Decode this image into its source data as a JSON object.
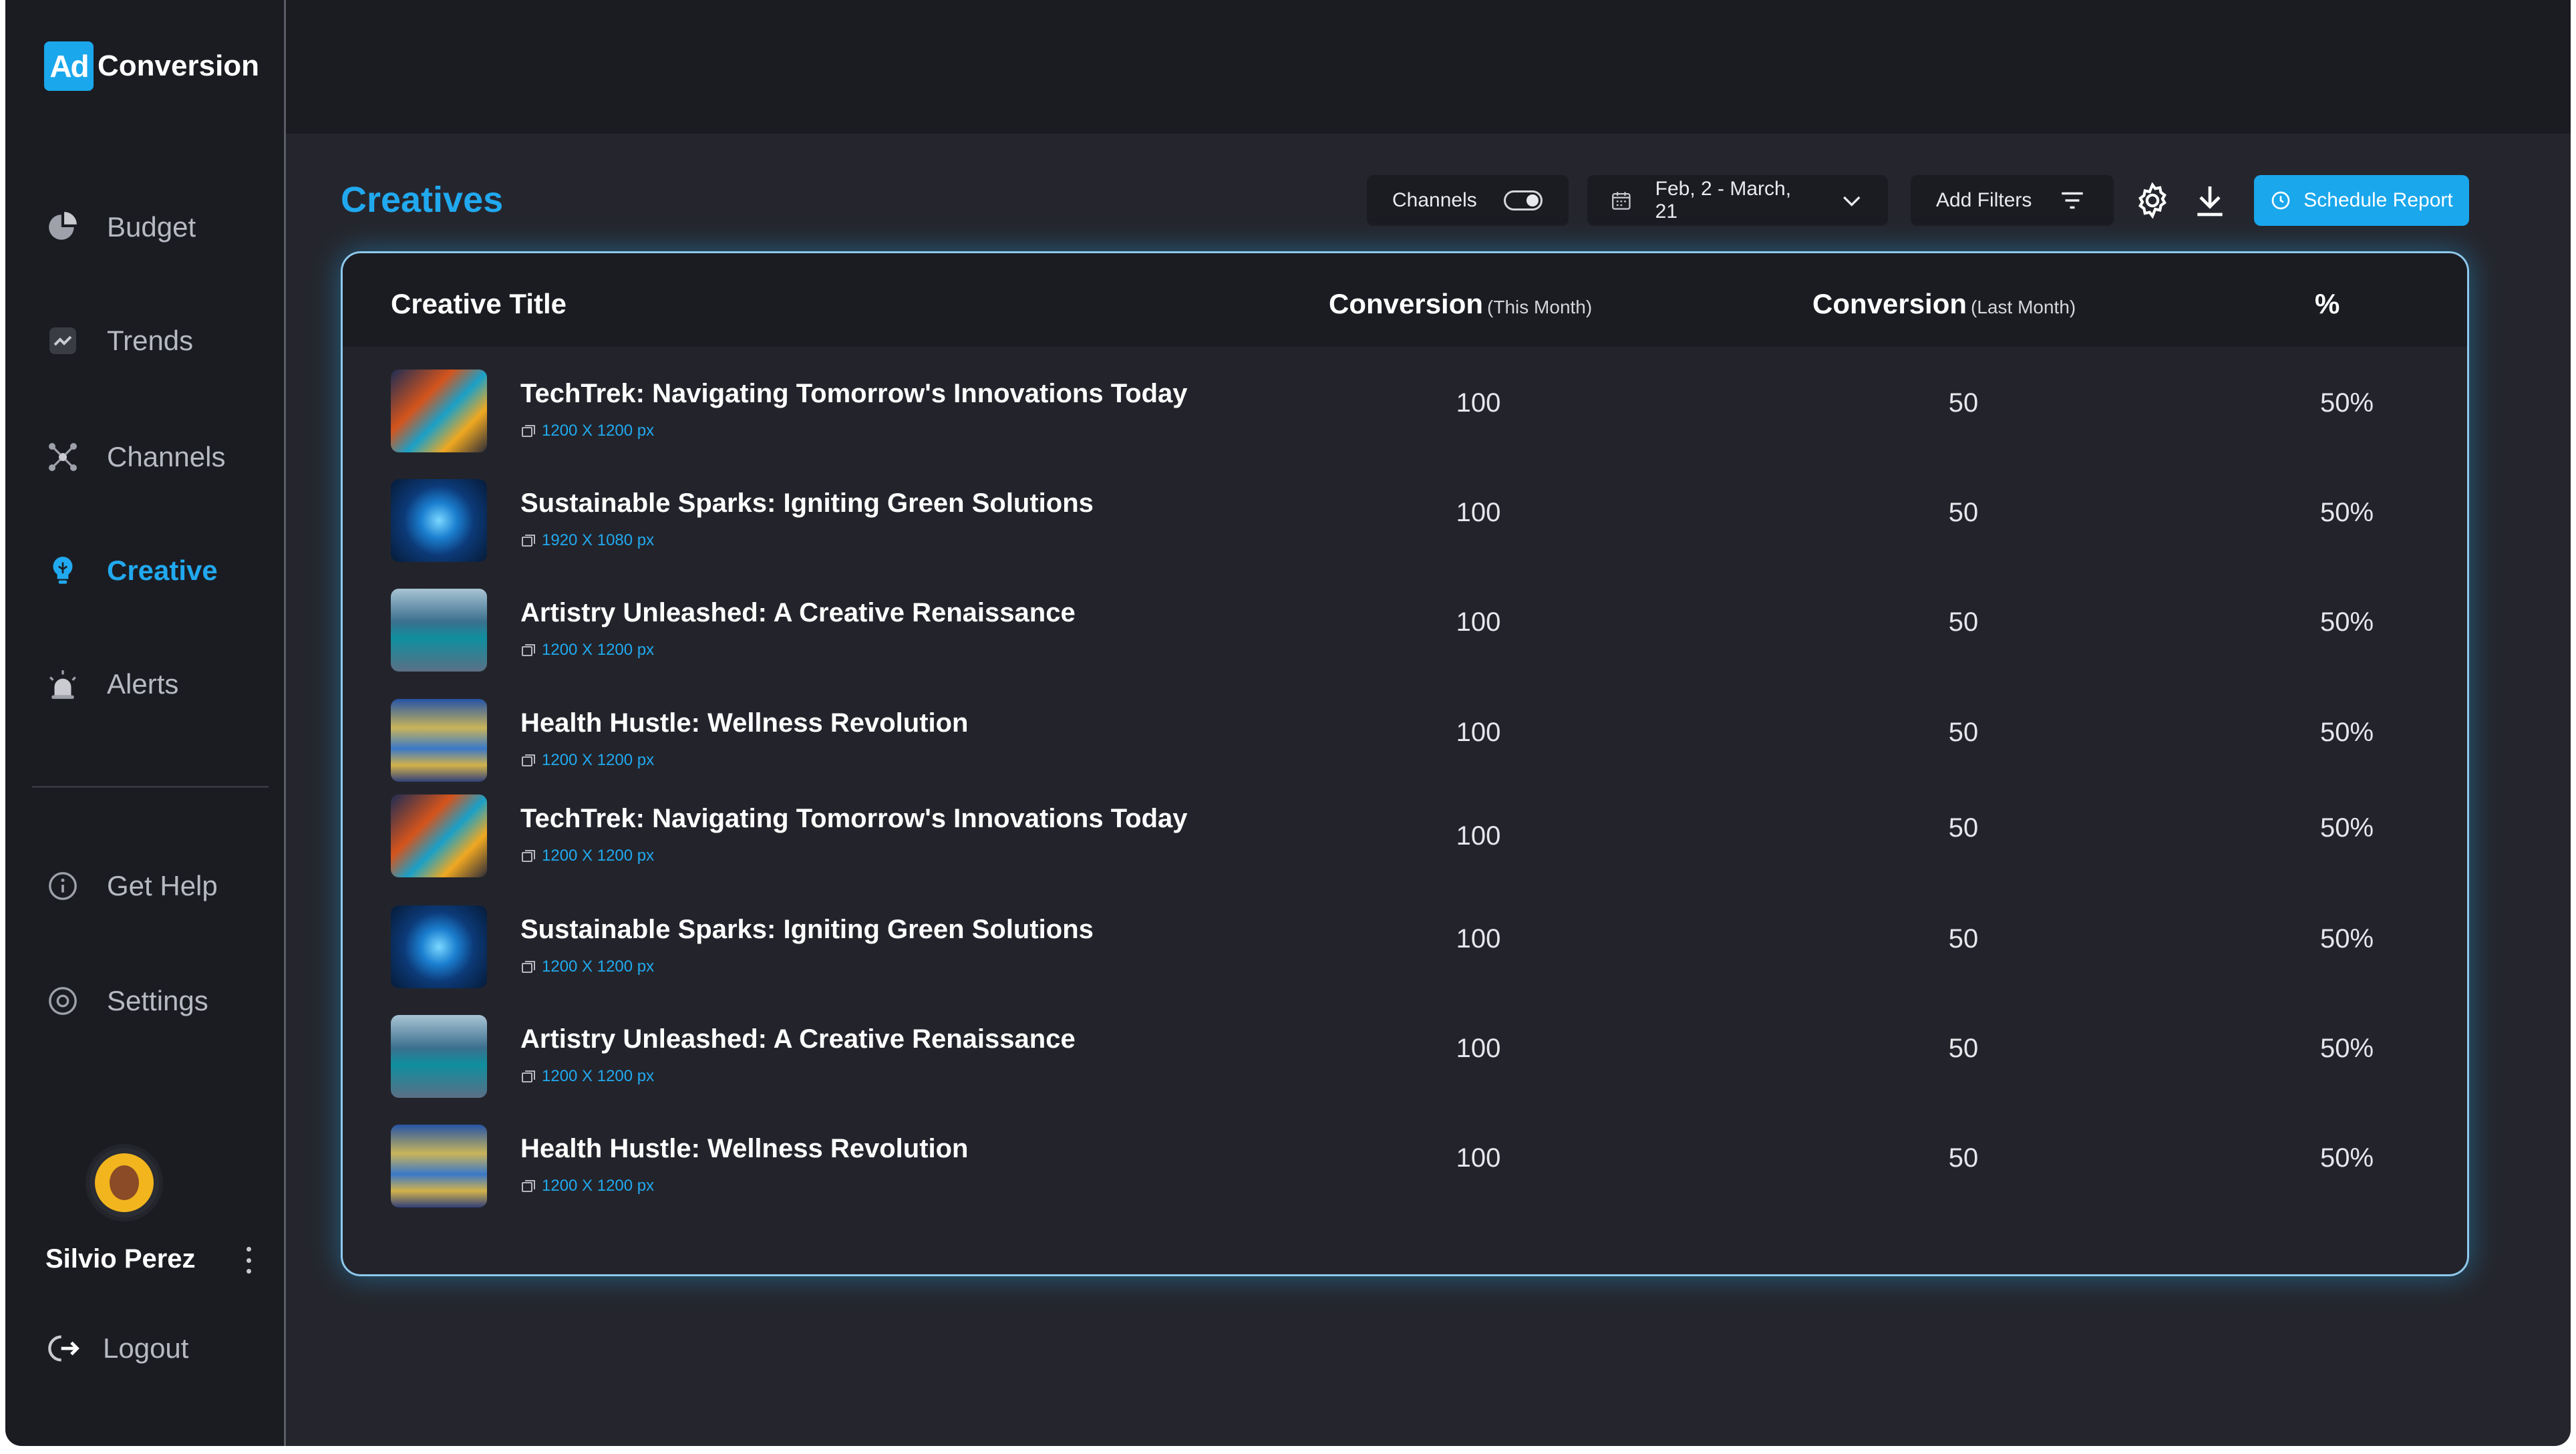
{
  "brand": {
    "mark": "Ad",
    "name": "Conversion"
  },
  "nav": {
    "items": [
      {
        "label": "Budget",
        "icon": "pie-chart-icon"
      },
      {
        "label": "Trends",
        "icon": "trend-icon"
      },
      {
        "label": "Channels",
        "icon": "channels-icon"
      },
      {
        "label": "Creative",
        "icon": "lightbulb-icon",
        "active": true
      },
      {
        "label": "Alerts",
        "icon": "alarm-icon"
      }
    ],
    "secondary": [
      {
        "label": "Get Help",
        "icon": "info-icon"
      },
      {
        "label": "Settings",
        "icon": "gear-icon"
      }
    ]
  },
  "user": {
    "name": "Silvio Perez",
    "logout_label": "Logout"
  },
  "page": {
    "title": "Creatives"
  },
  "toolbar": {
    "channels_label": "Channels",
    "channels_toggle_on": true,
    "date_range": "Feb, 2 - March, 21",
    "filters_label": "Add Filters",
    "schedule_label": "Schedule Report"
  },
  "table": {
    "headers": {
      "title": "Creative Title",
      "this_month": "Conversion",
      "this_month_note": "(This Month)",
      "last_month": "Conversion",
      "last_month_note": "(Last Month)",
      "percent": "%"
    },
    "rows": [
      {
        "title": "TechTrek: Navigating Tomorrow's Innovations Today",
        "dims": "1200 X 1200 px",
        "this_month": "100",
        "last_month": "50",
        "percent": "50%"
      },
      {
        "title": "Sustainable Sparks: Igniting Green Solutions",
        "dims": "1920 X 1080 px",
        "this_month": "100",
        "last_month": "50",
        "percent": "50%"
      },
      {
        "title": "Artistry Unleashed: A Creative Renaissance",
        "dims": "1200 X 1200 px",
        "this_month": "100",
        "last_month": "50",
        "percent": "50%"
      },
      {
        "title": "Health Hustle: Wellness Revolution",
        "dims": "1200 X 1200 px",
        "this_month": "100",
        "last_month": "50",
        "percent": "50%"
      },
      {
        "title": "TechTrek: Navigating Tomorrow's Innovations Today",
        "dims": "1200 X 1200 px",
        "this_month": "100",
        "last_month": "50",
        "percent": "50%"
      },
      {
        "title": "Sustainable Sparks: Igniting Green Solutions",
        "dims": "1200 X 1200 px",
        "this_month": "100",
        "last_month": "50",
        "percent": "50%"
      },
      {
        "title": "Artistry Unleashed: A Creative Renaissance",
        "dims": "1200 X 1200 px",
        "this_month": "100",
        "last_month": "50",
        "percent": "50%"
      },
      {
        "title": "Health Hustle: Wellness Revolution",
        "dims": "1200 X 1200 px",
        "this_month": "100",
        "last_month": "50",
        "percent": "50%"
      }
    ]
  },
  "colors": {
    "accent": "#21a9ef",
    "sidebar_bg": "#1b1c22",
    "main_bg": "#25262d"
  }
}
